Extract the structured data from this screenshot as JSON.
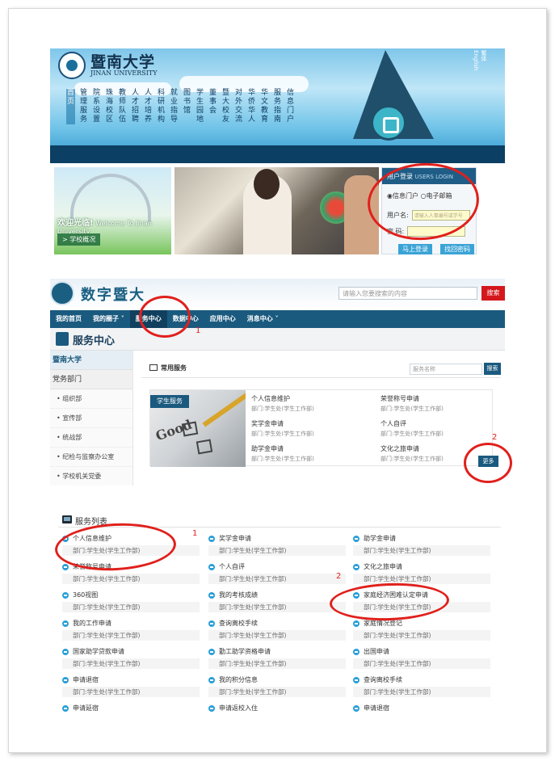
{
  "jnu": {
    "name_cn": "暨南大学",
    "name_en": "JINAN UNIVERSITY",
    "lang": [
      "繁体",
      "English"
    ],
    "nav": [
      "首页",
      "管理服务",
      "院系设置",
      "珠海校区",
      "教师队伍",
      "人才招聘",
      "人才培养",
      "科研机构",
      "就业指导",
      "图书馆",
      "学生园地",
      "董事会",
      "暨大校友",
      "对外交流",
      "华侨华人",
      "华文教育",
      "服务指南",
      "信息门户"
    ],
    "welcome_cn": "欢迎光临!",
    "welcome_en": "Welcome To Jinan University",
    "profile_link": "> 学校概况",
    "login": {
      "title": "用户登录",
      "title_en": "USERS LOGIN",
      "radio_portal": "◉信息门户",
      "radio_mail": "○电子邮箱",
      "username_label": "用户名:",
      "username_placeholder": "请输入人事编号或学号",
      "password_label": "密 码:",
      "login_btn": "马上登录",
      "forgot_btn": "找回密码"
    }
  },
  "portal": {
    "title": "数字暨大",
    "search_placeholder": "请输入您要搜索的内容",
    "search_btn": "搜索",
    "nav": [
      {
        "label": "我的首页"
      },
      {
        "label": "我的圈子 ˅"
      },
      {
        "label": "服务中心"
      },
      {
        "label": "数据中心"
      },
      {
        "label": "应用中心"
      },
      {
        "label": "消息中心 ˅"
      }
    ],
    "sub_title": "服务中心",
    "sidebar": {
      "head": "暨南大学",
      "group": "党务部门",
      "items": [
        "• 组织部",
        "• 宣传部",
        "• 统战部",
        "• 纪检与监察办公室",
        "• 学校机关党委"
      ]
    },
    "main_title": "常用服务",
    "svc_search_placeholder": "服务名称",
    "svc_search_btn": "搜索",
    "category_label": "学生服务",
    "cells": [
      {
        "name": "个人信息维护",
        "dept": "部门:学生处(学生工作部)"
      },
      {
        "name": "荣誉称号申请",
        "dept": "部门:学生处(学生工作部)"
      },
      {
        "name": "奖学金申请",
        "dept": "部门:学生处(学生工作部)"
      },
      {
        "name": "个人自评",
        "dept": "部门:学生处(学生工作部)"
      },
      {
        "name": "助学金申请",
        "dept": "部门:学生处(学生工作部)"
      },
      {
        "name": "文化之旅申请",
        "dept": "部门:学生处(学生工作部)"
      }
    ],
    "more_btn": "更多"
  },
  "service_list": {
    "title": "服务列表",
    "items": [
      {
        "name": "个人信息维护",
        "dept": "部门:学生处(学生工作部)"
      },
      {
        "name": "奖学金申请",
        "dept": "部门:学生处(学生工作部)"
      },
      {
        "name": "助学金申请",
        "dept": "部门:学生处(学生工作部)"
      },
      {
        "name": "荣誉称号申请",
        "dept": "部门:学生处(学生工作部)"
      },
      {
        "name": "个人自评",
        "dept": "部门:学生处(学生工作部)"
      },
      {
        "name": "文化之旅申请",
        "dept": "部门:学生处(学生工作部)"
      },
      {
        "name": "360视图",
        "dept": "部门:学生处(学生工作部)"
      },
      {
        "name": "我的考核成绩",
        "dept": "部门:学生处(学生工作部)"
      },
      {
        "name": "家庭经济困难认定申请",
        "dept": "部门:学生处(学生工作部)"
      },
      {
        "name": "我的工作申请",
        "dept": "部门:学生处(学生工作部)"
      },
      {
        "name": "查询离校手续",
        "dept": "部门:学生处(学生工作部)"
      },
      {
        "name": "家庭情况登记",
        "dept": "部门:学生处(学生工作部)"
      },
      {
        "name": "国家助学贷款申请",
        "dept": "部门:学生处(学生工作部)"
      },
      {
        "name": "勤工助学资格申请",
        "dept": "部门:学生处(学生工作部)"
      },
      {
        "name": "出国申请",
        "dept": "部门:学生处(学生工作部)"
      },
      {
        "name": "申请退宿",
        "dept": "部门:学生处(学生工作部)"
      },
      {
        "name": "我的积分信息",
        "dept": "部门:学生处(学生工作部)"
      },
      {
        "name": "查询离校手续",
        "dept": "部门:学生处(学生工作部)"
      },
      {
        "name": "申请延宿",
        "dept": ""
      },
      {
        "name": "申请返校入住",
        "dept": ""
      },
      {
        "name": "申请退宿",
        "dept": ""
      }
    ]
  },
  "annotations": {
    "n1": "1",
    "n2": "2",
    "n3": "1",
    "n4": "2"
  },
  "colors": {
    "accent": "#1b5a7f",
    "annotation": "#e0201c",
    "search_btn": "#d4171c"
  }
}
